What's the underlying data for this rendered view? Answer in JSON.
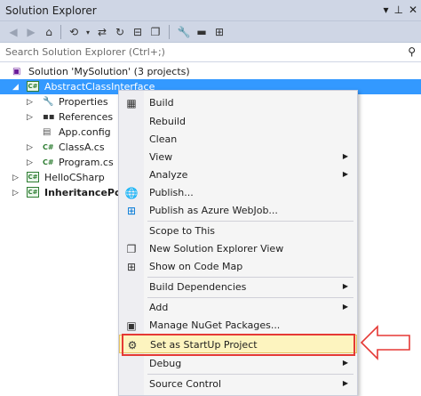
{
  "window": {
    "title": "Solution Explorer",
    "title_icons": [
      "pin-icon",
      "auto-hide-icon",
      "close-icon"
    ],
    "title_glyphs": [
      "▾",
      "⊥",
      "✕"
    ]
  },
  "toolbar": {
    "buttons": [
      "back",
      "forward",
      "home",
      "pending-changes-filter",
      "sync-with-document",
      "refresh",
      "collapse-all",
      "show-all-files",
      "properties",
      "preview-selected",
      "view-class-diagram"
    ]
  },
  "search": {
    "placeholder": "Search Solution Explorer (Ctrl+;)"
  },
  "tree": {
    "solution": "Solution 'MySolution' (3 projects)",
    "project1": "AbstractClassInterface",
    "items": {
      "properties": "Properties",
      "references": "References",
      "appconfig": "App.config",
      "classa": "ClassA.cs",
      "program": "Program.cs"
    },
    "project2": "HelloCSharp",
    "project3": "InheritancePolyr"
  },
  "context_menu": {
    "items": [
      {
        "label": "Build"
      },
      {
        "label": "Rebuild"
      },
      {
        "label": "Clean"
      },
      {
        "label": "View"
      },
      {
        "label": "Analyze"
      },
      {
        "label": "Publish..."
      },
      {
        "label": "Publish as Azure WebJob..."
      },
      {
        "label": "Scope to This"
      },
      {
        "label": "New Solution Explorer View"
      },
      {
        "label": "Show on Code Map"
      },
      {
        "label": "Build Dependencies"
      },
      {
        "label": "Add"
      },
      {
        "label": "Manage NuGet Packages..."
      },
      {
        "label": "Set as StartUp Project"
      },
      {
        "label": "Debug"
      },
      {
        "label": "Source Control"
      }
    ],
    "highlighted": "Set as StartUp Project"
  },
  "colors": {
    "selection": "#3399ff",
    "highlight_box": "#e53935",
    "callout_arrow": "#e53935"
  }
}
